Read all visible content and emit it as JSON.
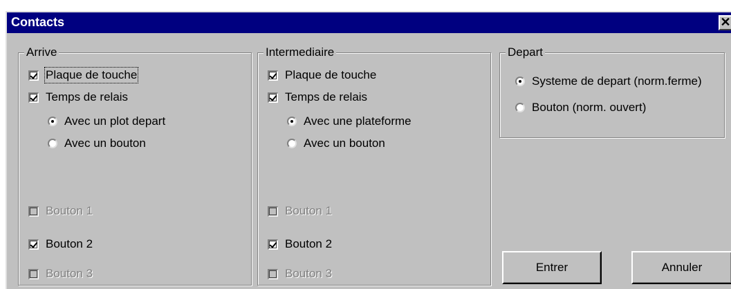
{
  "window": {
    "title": "Contacts",
    "close_glyph": "✕"
  },
  "arrive": {
    "legend": "Arrive",
    "plaque": {
      "label": "Plaque de touche",
      "checked": true
    },
    "temps": {
      "label": "Temps de relais",
      "checked": true
    },
    "radio1": {
      "label": "Avec un plot depart",
      "selected": true
    },
    "radio2": {
      "label": "Avec un bouton",
      "selected": false
    },
    "bouton1": {
      "label": "Bouton 1",
      "checked": false,
      "enabled": false
    },
    "bouton2": {
      "label": "Bouton 2",
      "checked": true,
      "enabled": true
    },
    "bouton3": {
      "label": "Bouton 3",
      "checked": false,
      "enabled": false
    }
  },
  "intermediaire": {
    "legend": "Intermediaire",
    "plaque": {
      "label": "Plaque de touche",
      "checked": true
    },
    "temps": {
      "label": "Temps de relais",
      "checked": true
    },
    "radio1": {
      "label": "Avec une plateforme",
      "selected": true
    },
    "radio2": {
      "label": "Avec un bouton",
      "selected": false
    },
    "bouton1": {
      "label": "Bouton 1",
      "checked": false,
      "enabled": false
    },
    "bouton2": {
      "label": "Bouton 2",
      "checked": true,
      "enabled": true
    },
    "bouton3": {
      "label": "Bouton 3",
      "checked": false,
      "enabled": false
    }
  },
  "depart": {
    "legend": "Depart",
    "radio1": {
      "label": "Systeme de depart (norm.ferme)",
      "selected": true
    },
    "radio2": {
      "label": "Bouton (norm. ouvert)",
      "selected": false
    }
  },
  "buttons": {
    "ok": "Entrer",
    "cancel": "Annuler"
  }
}
